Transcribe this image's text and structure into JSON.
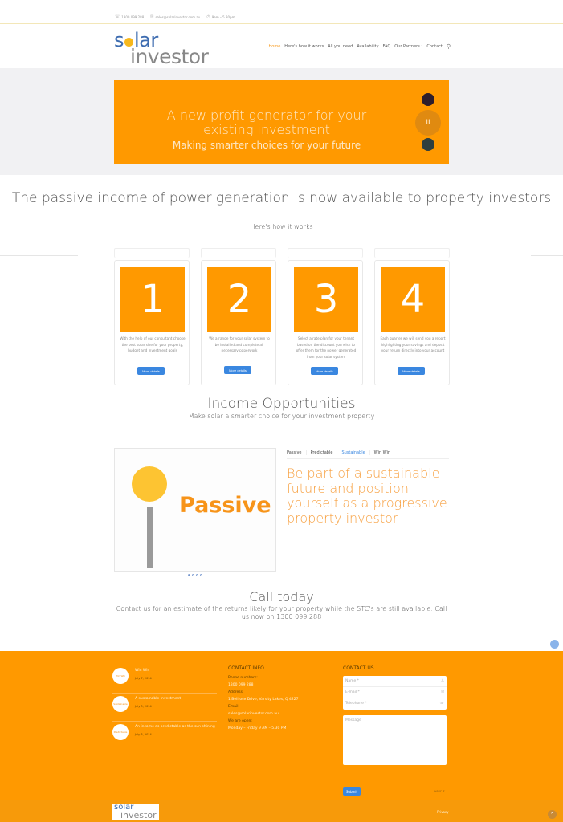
{
  "topbar": {
    "phone": "1300 099 288",
    "email": "sales@solarinvestor.com.au",
    "hours": "9am – 5.30pm"
  },
  "logo": {
    "line1_a": "s",
    "line1_b": "lar",
    "line2": "investor"
  },
  "nav": {
    "items": [
      "Home",
      "Here's how it works",
      "All you need",
      "Availability",
      "FAQ",
      "Our Partners",
      "Contact"
    ],
    "active": "Home",
    "dropdown_marker": "›"
  },
  "hero": {
    "title": "A new profit generator for your existing investment",
    "subtitle": "Making smarter choices for your future",
    "pause_label": "II"
  },
  "how": {
    "title": "The passive income of power generation is now available to property investors",
    "subtitle": "Here's how it works",
    "steps": [
      {
        "number": "1",
        "text": "With the help of our consultant choose the best solar size for your property, budget and investment goals",
        "button": "More details"
      },
      {
        "number": "2",
        "text": "We arrange for your solar system to be installed and complete all necessary paperwork",
        "button": "More details"
      },
      {
        "number": "3",
        "text": "Select a rate plan for your tenant based on the discount you wish to offer them for the power generated from your solar system",
        "button": "More details"
      },
      {
        "number": "4",
        "text": "Each quarter we will send you a report highlighting your savings and deposit your return directly into your account",
        "button": "More details"
      }
    ]
  },
  "income": {
    "title": "Income Opportunities",
    "subtitle": "Make solar a smarter choice for your investment property",
    "image_word": "Passive",
    "carousel_dots": 4,
    "carousel_active": 0,
    "tabs": [
      "Passive",
      "Predictable",
      "Sustainable",
      "Win Win"
    ],
    "active_tab": "Sustainable",
    "tab_text": "Be part of a sustainable future and position yourself as a progressive property investor"
  },
  "call": {
    "title": "Call today",
    "text": "Contact us for an estimate of the returns likely for your property while the STC's are still available. Call us now on 1300 099 288"
  },
  "footer": {
    "posts": [
      {
        "thumb": "Win Win",
        "title": "Win Win",
        "date": "July 7, 2014"
      },
      {
        "thumb": "Sustainable",
        "title": "A sustainable investment",
        "date": "July 3, 2014"
      },
      {
        "thumb": "Predictable",
        "title": "An income as predictable as the sun shining",
        "date": "July 3, 2014"
      }
    ],
    "contact_info": {
      "heading": "CONTACT INFO",
      "phone_label": "Phone numbers:",
      "phone": "1300 099 288",
      "address_label": "Address:",
      "address": "1 Bellrose Drive, Varsity Lakes, Q 4227",
      "email_label": "Email:",
      "email": "sales@solarinvestor.com.au",
      "open_label": "We are open:",
      "open": "Monday – Friday 9 AM – 5.30 PM"
    },
    "contact_us": {
      "heading": "CONTACT US",
      "name_placeholder": "Name *",
      "email_placeholder": "E-mail *",
      "phone_placeholder": "Telephone *",
      "message_placeholder": "Message",
      "submit": "Submit",
      "captcha": "user ⟳"
    },
    "bottom": {
      "logo_a": "solar",
      "logo_b": "investor",
      "privacy": "Privacy",
      "up": "^"
    }
  },
  "colors": {
    "brand_orange": "#ff9900",
    "brand_blue": "#3d6cb0",
    "button_blue": "#3a87e0",
    "sun_yellow": "#fdc432"
  }
}
